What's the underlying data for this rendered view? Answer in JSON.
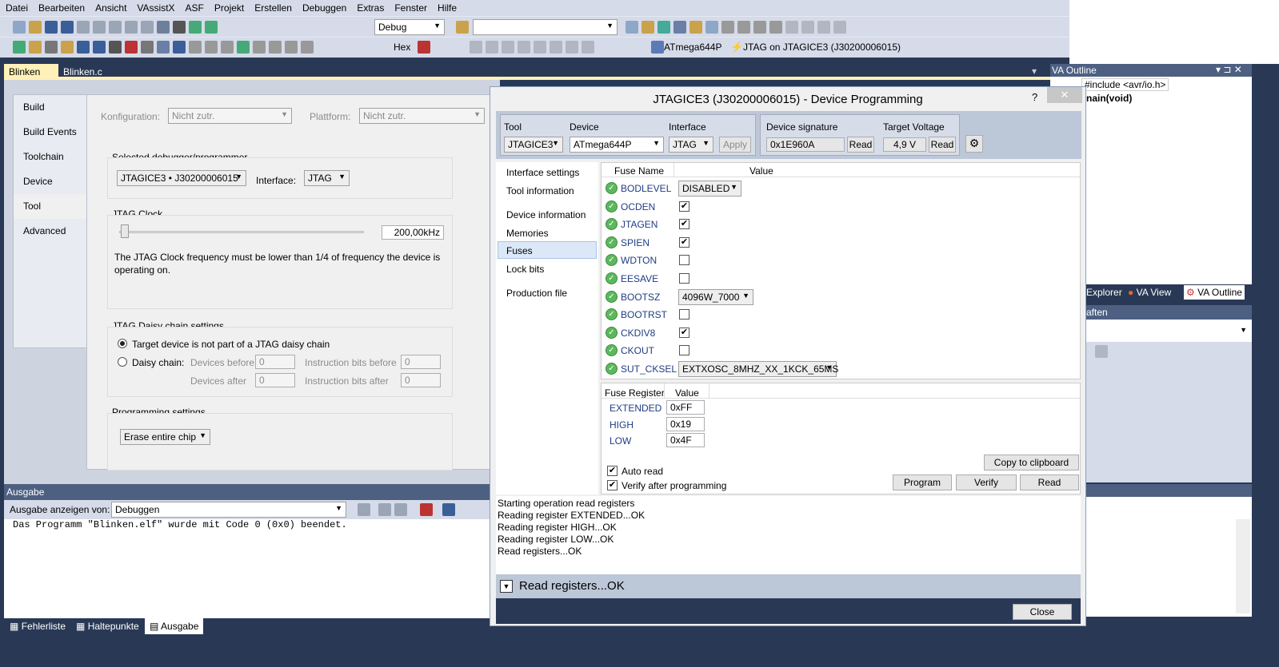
{
  "menu": [
    "Datei",
    "Bearbeiten",
    "Ansicht",
    "VAssistX",
    "ASF",
    "Projekt",
    "Erstellen",
    "Debuggen",
    "Extras",
    "Fenster",
    "Hilfe"
  ],
  "toolbar": {
    "config": "Debug",
    "hex": "Hex",
    "device": "ATmega644P",
    "tool": "JTAG on JTAGICE3 (J30200006015)"
  },
  "doc_tabs": [
    "Blinken",
    "Blinken.c"
  ],
  "left_tabs": [
    "Build",
    "Build Events",
    "Toolchain",
    "Device",
    "Tool",
    "Advanced"
  ],
  "tool_panel": {
    "config_label": "Konfiguration:",
    "config_value": "Nicht zutr.",
    "platform_label": "Plattform:",
    "platform_value": "Nicht zutr.",
    "debugger_title": "Selected debugger/programmer",
    "debugger": "JTAGICE3 • J30200006015",
    "interface_label": "Interface:",
    "interface": "JTAG",
    "clock_title": "JTAG Clock",
    "clock_value": "200,00kHz",
    "clock_slider_fraction": 0.0,
    "clock_note": "The JTAG Clock frequency must be lower than 1/4 of frequency the device is operating on.",
    "daisy_title": "JTAG Daisy chain settings",
    "daisy_opt1": "Target device is not part of a JTAG daisy chain",
    "daisy_opt2": "Daisy chain:",
    "dev_before": "Devices before",
    "dev_after": "Devices after",
    "ins_before": "Instruction bits before",
    "ins_after": "Instruction bits after",
    "zero": "0",
    "prog_title": "Programming settings",
    "erase": "Erase entire chip"
  },
  "output": {
    "title": "Ausgabe",
    "show_label": "Ausgabe anzeigen von:",
    "source": "Debuggen",
    "line": "Das Programm \"Blinken.elf\" wurde mit Code 0 (0x0) beendet."
  },
  "bottom_tabs": [
    "Fehlerliste",
    "Haltepunkte",
    "Ausgabe"
  ],
  "va_outline": {
    "title": "VA Outline",
    "include": "#include <avr/io.h>",
    "main": "nain(void)",
    "tabs": [
      "Explorer",
      "VA View",
      "VA Outline"
    ],
    "props": "aften"
  },
  "dialog": {
    "title": "JTAGICE3 (J30200006015) - Device Programming",
    "help": "?",
    "tool_label": "Tool",
    "device_label": "Device",
    "interface_label": "Interface",
    "tool": "JTAGICE3",
    "device": "ATmega644P",
    "interface": "JTAG",
    "apply": "Apply",
    "sig_label": "Device signature",
    "sig": "0x1E960A",
    "volt_label": "Target Voltage",
    "volt": "4,9 V",
    "read": "Read",
    "nav": [
      "Interface settings",
      "Tool information",
      "Device information",
      "Memories",
      "Fuses",
      "Lock bits",
      "Production file"
    ],
    "fuse_col1": "Fuse Name",
    "fuse_col2": "Value",
    "fuses": [
      {
        "name": "BODLEVEL",
        "type": "select",
        "value": "DISABLED"
      },
      {
        "name": "OCDEN",
        "type": "check",
        "value": "✔"
      },
      {
        "name": "JTAGEN",
        "type": "check",
        "value": "✔"
      },
      {
        "name": "SPIEN",
        "type": "check",
        "value": "✔"
      },
      {
        "name": "WDTON",
        "type": "check",
        "value": ""
      },
      {
        "name": "EESAVE",
        "type": "check",
        "value": ""
      },
      {
        "name": "BOOTSZ",
        "type": "select",
        "value": "4096W_7000"
      },
      {
        "name": "BOOTRST",
        "type": "check",
        "value": ""
      },
      {
        "name": "CKDIV8",
        "type": "check",
        "value": "✔"
      },
      {
        "name": "CKOUT",
        "type": "check",
        "value": ""
      },
      {
        "name": "SUT_CKSEL",
        "type": "select",
        "value": "EXTXOSC_8MHZ_XX_1KCK_65MS"
      }
    ],
    "reg_col1": "Fuse Register",
    "reg_col2": "Value",
    "registers": [
      {
        "name": "EXTENDED",
        "value": "0xFF"
      },
      {
        "name": "HIGH",
        "value": "0x19"
      },
      {
        "name": "LOW",
        "value": "0x4F"
      }
    ],
    "auto_read": "Auto read",
    "verify_after": "Verify after programming",
    "copy": "Copy to clipboard",
    "program": "Program",
    "verify": "Verify",
    "read_btn": "Read",
    "log": [
      "Starting operation read registers",
      "Reading register EXTENDED...OK",
      "Reading register HIGH...OK",
      "Reading register LOW...OK",
      "Read registers...OK"
    ],
    "status": "Read registers...OK",
    "close": "Close"
  }
}
